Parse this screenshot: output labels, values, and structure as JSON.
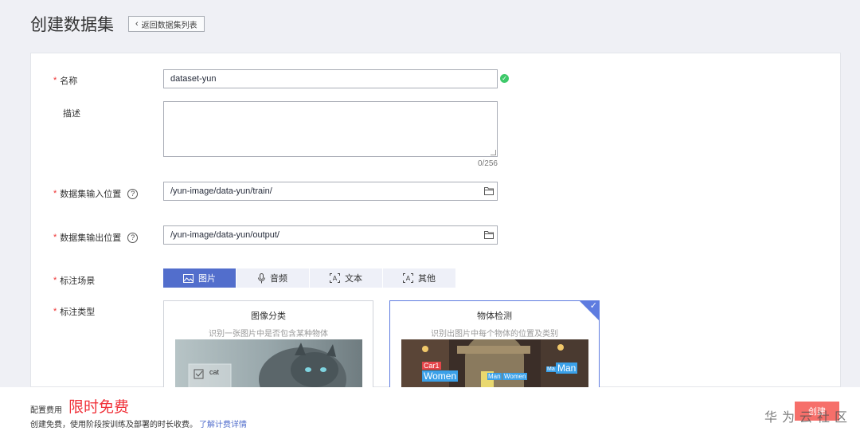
{
  "header": {
    "title": "创建数据集",
    "back_label": "返回数据集列表"
  },
  "form": {
    "name": {
      "label": "名称",
      "value": "dataset-yun"
    },
    "description": {
      "label": "描述",
      "counter": "0/256"
    },
    "input_path": {
      "label": "数据集输入位置",
      "value": "/yun-image/data-yun/train/"
    },
    "output_path": {
      "label": "数据集输出位置",
      "value": "/yun-image/data-yun/output/"
    },
    "scene": {
      "label": "标注场景",
      "tabs": [
        "图片",
        "音频",
        "文本",
        "其他"
      ],
      "selected": "图片"
    },
    "label_type": {
      "label": "标注类型",
      "options": [
        {
          "title": "图像分类",
          "desc": "识别一张图片中是否包含某种物体",
          "thumb_tag": "cat"
        },
        {
          "title": "物体检测",
          "desc": "识别出图片中每个物体的位置及类别",
          "thumb_tags": [
            "Car1",
            "Women",
            "Man",
            "Women",
            "Ma",
            "Man"
          ]
        }
      ],
      "selected": "物体检测"
    }
  },
  "footer": {
    "fee_label": "配置费用",
    "fee_value": "限时免费",
    "note": "创建免费，使用阶段按训练及部署的时长收费。",
    "link": "了解计费详情",
    "create_label": "创建",
    "watermark": "华为云社区"
  },
  "colors": {
    "accent": "#526ecc",
    "required": "#e33333",
    "fee": "#f0323a",
    "success": "#3ec96a"
  }
}
